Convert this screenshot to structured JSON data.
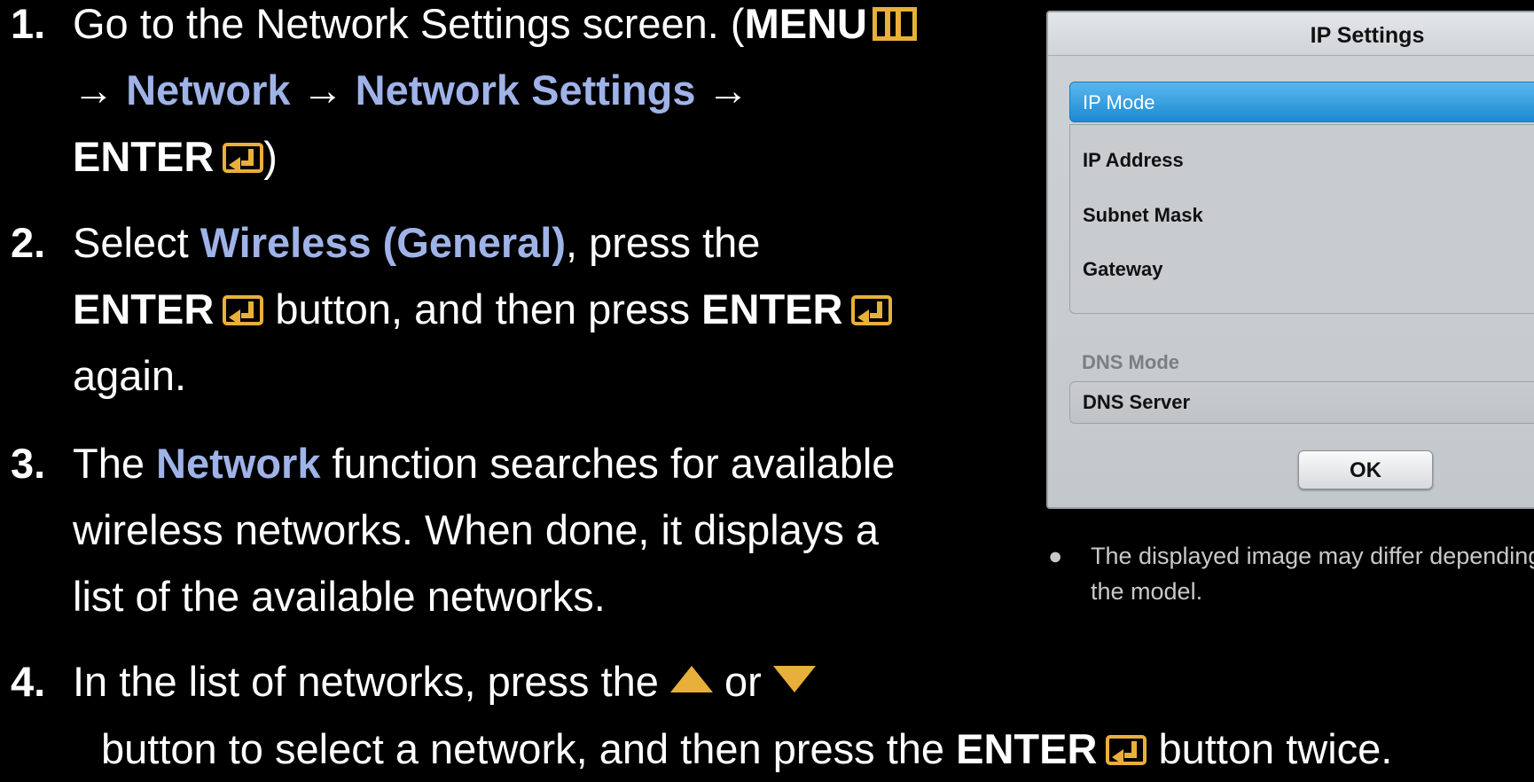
{
  "steps": [
    {
      "number": "1.",
      "lines": {
        "l1_text": "Go to the Network Settings screen. (",
        "l1_menu": "MENU",
        "l2_arrow1": "→ ",
        "l2_network": "Network",
        "l2_arrow2": " → ",
        "l2_network_settings": "Network Settings",
        "l2_arrow3": " →",
        "l3_enter": "ENTER",
        "l3_close": ")"
      }
    },
    {
      "number": "2.",
      "lines": {
        "l1_text": "Select ",
        "l1_wireless": "Wireless (General)",
        "l1_rest": ", press the",
        "l2_enter1": "ENTER",
        "l2_text": " button, and then press ",
        "l2_enter2": "ENTER",
        "l3_text": "again."
      }
    },
    {
      "number": "3.",
      "lines": {
        "l1_the": "The ",
        "l1_network": "Network",
        "l1_rest": " function searches for available",
        "l2_text": "wireless networks. When done, it displays a",
        "l3_text": "list of the available networks."
      }
    },
    {
      "number": "4.",
      "lines": {
        "l1_text": "In the list of networks, press the ",
        "l1_or": " or ",
        "l2_text": "button to select a network, and then press the ",
        "l2_enter": "ENTER",
        "l2_rest": " button twice."
      }
    }
  ],
  "dialog": {
    "title": "IP Settings",
    "selected_row": "IP Mode",
    "fields": [
      "IP Address",
      "Subnet Mask",
      "Gateway"
    ],
    "dns_mode": "DNS Mode",
    "dns_server": "DNS Server",
    "ok_label": "OK"
  },
  "note": {
    "bullet": "●",
    "line1": "The displayed image may differ depending on",
    "line2": "the model."
  },
  "colors": {
    "background": "#000000",
    "highlight_blue": "#9fb3e8",
    "icon_gold": "#e8b03a",
    "selected_row": "#1c8bd2"
  },
  "icons": [
    "menu-icon",
    "enter-icon",
    "up-arrow-icon",
    "down-arrow-icon"
  ]
}
